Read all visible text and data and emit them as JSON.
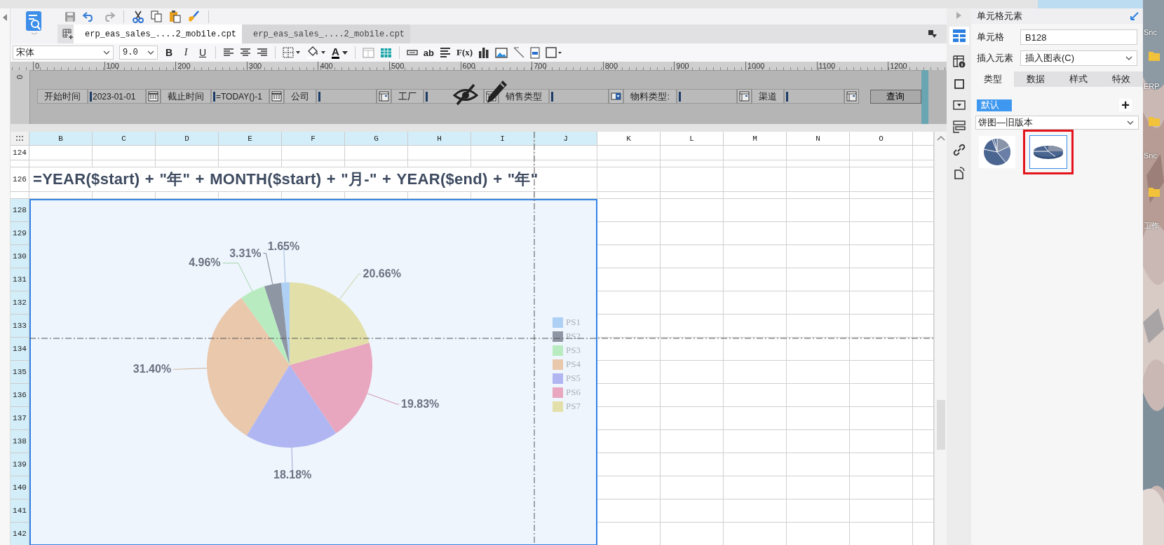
{
  "document_tabs": [
    {
      "label": "erp_eas_sales_....2_mobile.cpt",
      "selected": true
    },
    {
      "label": "erp_eas_sales_....2_mobile.cpt",
      "selected": false
    }
  ],
  "format_toolbar": {
    "font": "宋体",
    "font_size": "9.0",
    "bold": "B",
    "italic": "I",
    "underline": "U",
    "font_color": "A",
    "text_tool": "ab",
    "formula_tool": "F(x)"
  },
  "ruler": {
    "marks": [
      "0",
      "100",
      "200",
      "300",
      "400",
      "500",
      "600",
      "700",
      "800",
      "900",
      "1000",
      "1100",
      "1200"
    ],
    "vertical_mark": "0"
  },
  "parameters": [
    {
      "label": "开始时间",
      "value": "2023-01-01",
      "kind": "date"
    },
    {
      "label": "截止时间",
      "value": "=TODAY()-1",
      "kind": "date"
    },
    {
      "label": "公司",
      "kind": "tree"
    },
    {
      "label": "工厂",
      "kind": "tree"
    },
    {
      "label": "销售类型",
      "kind": "combo"
    },
    {
      "label": "物料类型:",
      "kind": "tree"
    },
    {
      "label": "渠道",
      "kind": "tree"
    }
  ],
  "query_button": "查询",
  "sheet": {
    "columns": [
      {
        "label": "B",
        "selected": true
      },
      {
        "label": "C",
        "selected": true
      },
      {
        "label": "D",
        "selected": true
      },
      {
        "label": "E",
        "selected": true
      },
      {
        "label": "F",
        "selected": true
      },
      {
        "label": "G",
        "selected": true
      },
      {
        "label": "H",
        "selected": true
      },
      {
        "label": "I",
        "selected": true
      },
      {
        "label": "J",
        "selected": true
      },
      {
        "label": "K",
        "selected": false
      },
      {
        "label": "L",
        "selected": false
      },
      {
        "label": "M",
        "selected": false
      },
      {
        "label": "N",
        "selected": false
      },
      {
        "label": "O",
        "selected": false
      }
    ],
    "rows": [
      {
        "label": "124",
        "kind": "short",
        "selected": false
      },
      {
        "kind": "thin",
        "selected": false
      },
      {
        "label": "126",
        "kind": "tall",
        "selected": false
      },
      {
        "kind": "thin",
        "selected": false
      },
      {
        "label": "128",
        "kind": "normal",
        "selected": true
      },
      {
        "label": "129",
        "kind": "normal",
        "selected": true
      },
      {
        "label": "130",
        "kind": "normal",
        "selected": true
      },
      {
        "label": "131",
        "kind": "normal",
        "selected": true
      },
      {
        "label": "132",
        "kind": "normal",
        "selected": true
      },
      {
        "label": "133",
        "kind": "normal",
        "selected": true
      },
      {
        "label": "134",
        "kind": "normal",
        "selected": true
      },
      {
        "label": "135",
        "kind": "normal",
        "selected": true
      },
      {
        "label": "136",
        "kind": "normal",
        "selected": true
      },
      {
        "label": "137",
        "kind": "normal",
        "selected": true
      },
      {
        "label": "138",
        "kind": "normal",
        "selected": true
      },
      {
        "label": "139",
        "kind": "normal",
        "selected": true
      },
      {
        "label": "140",
        "kind": "normal",
        "selected": true
      },
      {
        "label": "141",
        "kind": "normal",
        "selected": true
      },
      {
        "label": "142",
        "kind": "normal",
        "selected": true
      }
    ],
    "formula": "=YEAR($start) + \"年\" + MONTH($start) + \"月-\" + YEAR($end) + \"年\"",
    "chart": {
      "chart_data": {
        "type": "pie",
        "categories": [
          "PS1",
          "PS2",
          "PS3",
          "PS4",
          "PS5",
          "PS6",
          "PS7"
        ],
        "values": [
          1.65,
          3.31,
          4.96,
          31.4,
          18.18,
          19.83,
          20.66
        ],
        "colors": [
          "#aed0f5",
          "#8e96a3",
          "#b8ecc0",
          "#e9c8ac",
          "#b0b6f2",
          "#e8a6bf",
          "#e2e0a8"
        ],
        "value_labels": [
          "1.65%",
          "3.31%",
          "4.96%",
          "31.40%",
          "18.18%",
          "19.83%",
          "20.66%"
        ],
        "legend": "right"
      }
    }
  },
  "side_panel": {
    "title": "单元格元素",
    "cell_label": "单元格",
    "cell_value": "B128",
    "insert_label": "插入元素",
    "insert_value": "插入图表(C)",
    "tabs": [
      {
        "label": "类型",
        "selected": true
      },
      {
        "label": "数据",
        "selected": false
      },
      {
        "label": "样式",
        "selected": false
      },
      {
        "label": "特效",
        "selected": false
      }
    ],
    "default_button": "默认",
    "add_button": "+",
    "chart_style": "饼图—旧版本",
    "thumbnails": [
      {
        "kind": "flat",
        "selected": false
      },
      {
        "kind": "tilted",
        "selected": true
      }
    ]
  },
  "desktop": {
    "labels": [
      "Snc",
      "ERP",
      "Snc",
      "工作"
    ]
  }
}
